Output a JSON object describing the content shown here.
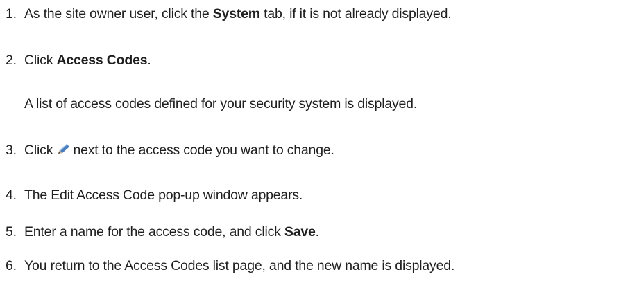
{
  "steps": [
    {
      "number": "1.",
      "before": "As the site owner user, click the ",
      "bold": "System",
      "after": " tab, if it is not already displayed."
    },
    {
      "number": "2.",
      "before": "Click ",
      "bold": "Access Codes",
      "after": "."
    },
    {
      "number": "3.",
      "before": "Click",
      "icon": "edit-pencil-icon",
      "after": "next to the access code you want to change."
    },
    {
      "number": "4.",
      "text": "The Edit Access Code pop-up window appears."
    },
    {
      "number": "5.",
      "before": "Enter a name for the access code, and click ",
      "bold": "Save",
      "after": "."
    },
    {
      "number": "6.",
      "text": "You return to the Access Codes list page, and the new name is displayed."
    }
  ],
  "note_after_step_2": "A list of access codes defined for your security system is displayed.",
  "colors": {
    "text": "#1f1f1f",
    "pencil_blue": "#4a7ebf",
    "pencil_light": "#a9c7ea"
  }
}
